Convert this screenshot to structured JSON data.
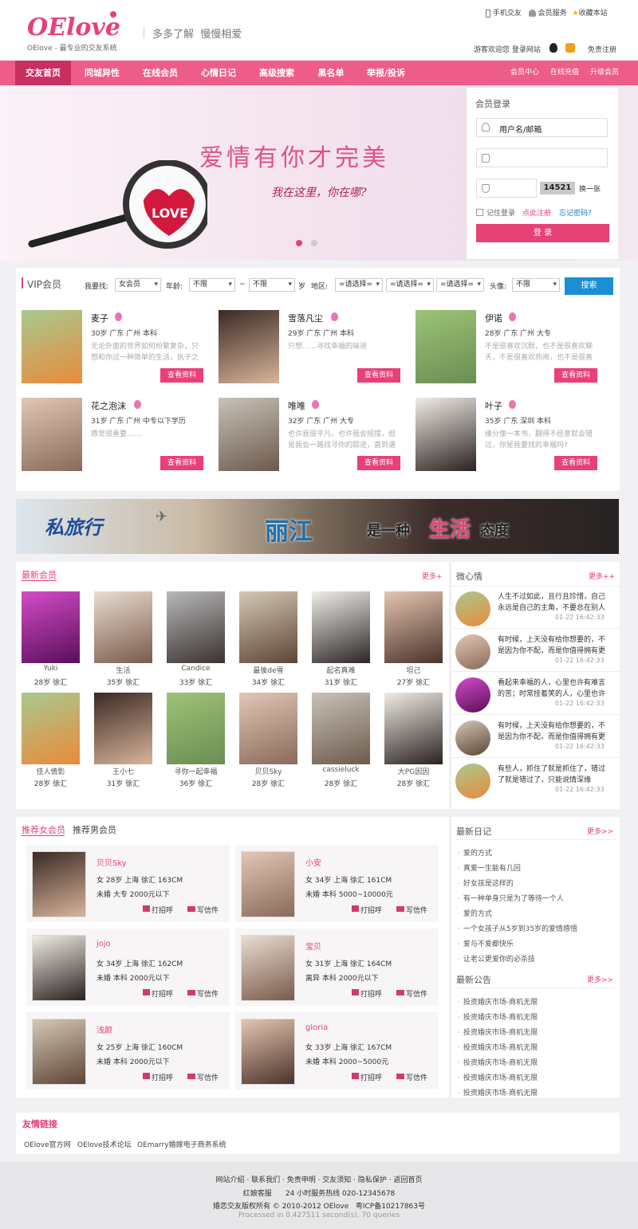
{
  "header": {
    "logo": "OElove",
    "slogan": "OElove - 最专业的交友系统",
    "tagline": "多多了解  慢慢相爱",
    "links": [
      "手机交友",
      "会员服务",
      "收藏本站"
    ],
    "welcome": "游客欢迎您 登录网站",
    "free_reg": "免责注册"
  },
  "nav": {
    "items": [
      "交友首页",
      "同城异性",
      "在线会员",
      "心情日记",
      "高级搜索",
      "黑名单",
      "举报/投诉"
    ],
    "right": [
      "会员中心",
      "在线充值",
      "升级会员"
    ]
  },
  "banner": {
    "title": "爱情有你才完美",
    "sub": "我在这里，你在哪?",
    "love": "LOVE"
  },
  "login": {
    "title": "会员登录",
    "user_placeholder": "用户名/邮箱",
    "captcha": "14521",
    "change": "换一张",
    "remember": "记住登录",
    "register": "点此注册",
    "forgot": "忘记密码?",
    "submit": "登 录"
  },
  "vip": {
    "title": "VIP会员",
    "find_label": "我要找:",
    "find_val": "女会员",
    "age_label": "年龄:",
    "age_from": "不限",
    "tilde": "~",
    "age_to": "不限",
    "age_unit": "岁",
    "area_label": "地区:",
    "area1": "=请选择=",
    "area2": "=请选择=",
    "area3": "=请选择=",
    "avatar_label": "头像:",
    "avatar_val": "不限",
    "search": "搜索",
    "view": "查看资料",
    "members": [
      {
        "name": "麦子",
        "info": "30岁 广东 广州 本科",
        "desc": "无论外面的世界如何纷繁复杂，只想和你过一种简单的生活，执子之"
      },
      {
        "name": "雪落凡尘",
        "info": "29岁 广东 广州 本科",
        "desc": "只想……寻找幸福的味道"
      },
      {
        "name": "伊诺",
        "info": "28岁 广东 广州 大专",
        "desc": "不是很喜欢沉默，也不是很喜欢聊天，不是很喜欢热闹，也不是很喜"
      },
      {
        "name": "花之泡沫",
        "info": "31岁 广东 广州 中专以下学历",
        "desc": "感觉很重要……"
      },
      {
        "name": "唯唯",
        "info": "32岁 广东 广州 大专",
        "desc": "也许我很平凡，也许我会摇摆，但是我会一路找寻你的踪迹，直到遇"
      },
      {
        "name": "叶子",
        "info": "35岁 广东 深圳 本科",
        "desc": "缘分像一本书，翻得不经意就会错过，你是我要找的幸福吗?"
      }
    ]
  },
  "ad": {
    "left": "私旅行",
    "mid1": "丽江",
    "mid2": "是一种",
    "mid3": "生活",
    "mid4": "态度"
  },
  "newest": {
    "title": "最新会员",
    "more": "更多+",
    "members": [
      {
        "name": "Yuki",
        "info": "28岁 徐汇"
      },
      {
        "name": "生活",
        "info": "35岁 徐汇"
      },
      {
        "name": "Candice",
        "info": "33岁 徐汇"
      },
      {
        "name": "最後de雪",
        "info": "34岁 徐汇"
      },
      {
        "name": "起名真难",
        "info": "31岁 徐汇"
      },
      {
        "name": "坦己",
        "info": "27岁 徐汇"
      },
      {
        "name": "佳人倩影",
        "info": "28岁 徐汇"
      },
      {
        "name": "王小七",
        "info": "31岁 徐汇"
      },
      {
        "name": "寻你一起幸福",
        "info": "36岁 徐汇"
      },
      {
        "name": "贝贝Sky",
        "info": "28岁 徐汇"
      },
      {
        "name": "cassieluck",
        "info": "28岁 徐汇"
      },
      {
        "name": "大PG因因",
        "info": "28岁 徐汇"
      }
    ]
  },
  "mood": {
    "title": "微心情",
    "more": "更多++",
    "items": [
      {
        "l1": "人生不过如此，且行且珍惜，自己",
        "l2": "永远是自己的主角，不要总在别人",
        "time": "01-22 16:42:33"
      },
      {
        "l1": "有时候，上天没有给你想要的，不",
        "l2": "是因为你不配，而是你值得拥有更",
        "time": "01-22 16:42:33"
      },
      {
        "l1": "看起来幸福的人，心里也许有难言",
        "l2": "的苦；时常挂着笑的人，心里也许",
        "time": "01-22 16:42:33"
      },
      {
        "l1": "有时候，上天没有给你想要的，不",
        "l2": "是因为你不配，而是你值得拥有更",
        "time": "01-22 16:42:33"
      },
      {
        "l1": "有些人，抓住了就是抓住了，错过",
        "l2": "了就是错过了，只能说情深缘",
        "time": "01-22 16:42:33"
      }
    ]
  },
  "recommend": {
    "tab1": "推荐女会员",
    "tab2": "推荐男会员",
    "greet": "打招呼",
    "mail": "写信件",
    "members": [
      {
        "name": "贝贝Sky",
        "l1": "女 28岁 上海 徐汇 163CM",
        "l2": "未婚 大专 2000元以下"
      },
      {
        "name": "小安",
        "l1": "女 34岁 上海 徐汇 161CM",
        "l2": "未婚 本科 5000~10000元"
      },
      {
        "name": "jojo",
        "l1": "女 34岁 上海 徐汇 162CM",
        "l2": "未婚 本科 2000元以下"
      },
      {
        "name": "宝贝",
        "l1": "女 31岁 上海 徐汇 164CM",
        "l2": "离异 本科 2000元以下"
      },
      {
        "name": "浅颜",
        "l1": "女 25岁 上海 徐汇 160CM",
        "l2": "未婚 本科 2000元以下"
      },
      {
        "name": "gloria",
        "l1": "女 33岁 上海 徐汇 167CM",
        "l2": "未婚 本科 2000~5000元"
      }
    ]
  },
  "diary": {
    "title": "最新日记",
    "more": "更多>>",
    "items": [
      "爱的方式",
      "真爱一生能有几回",
      "好女孩是这样的",
      "有一种单身只是为了等待一个人",
      "爱的方式",
      "一个女孩子从5岁到35岁的爱情感悟",
      "爱与不爱都快乐",
      "让老公更爱你的必杀技"
    ]
  },
  "notice": {
    "title": "最新公告",
    "more": "更多>>",
    "items": [
      "投资婚庆市场-商机无限",
      "投资婚庆市场-商机无限",
      "投资婚庆市场-商机无限",
      "投资婚庆市场-商机无限",
      "投资婚庆市场-商机无限",
      "投资婚庆市场-商机无限",
      "投资婚庆市场-商机无限"
    ]
  },
  "friends": {
    "title": "友情链接",
    "links": [
      "OElove官方网",
      "OElove技术论坛",
      "OEmarry婚嫁电子商务系统"
    ]
  },
  "footer": {
    "links": "网站介绍 · 联系我们 · 免责申明 · 交友须知 · 隐私保护 · 返回首页",
    "service": "红娘客服      24 小时服务热线 020-12345678",
    "copy": "婚恋交友版权所有 © 2010-2012 OElove   粤ICP备10217863号",
    "proc": "Processed in 0.427511 second(s), 70 queries"
  },
  "colors": {
    "brand": "#ee5c8a",
    "accent": "#e74177",
    "blue": "#1a8fd4"
  }
}
